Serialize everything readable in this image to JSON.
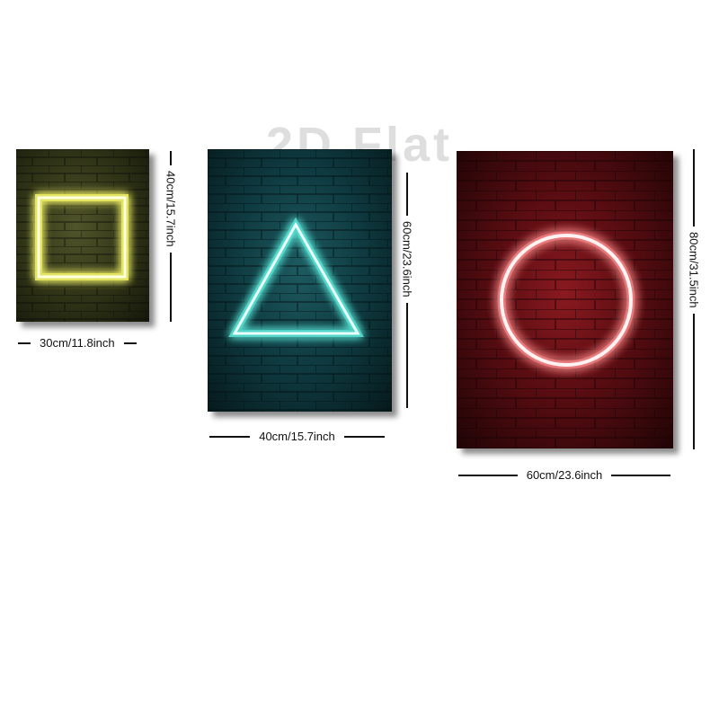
{
  "watermark": "2D Flat",
  "panels": [
    {
      "id": "square",
      "shape": "square",
      "width_label": "30cm/11.8inch",
      "height_label": "40cm/15.7inch",
      "bg_color": "#2f3316",
      "glow_color": "#ffff8a",
      "shape_icon": "neon-square-icon"
    },
    {
      "id": "triangle",
      "shape": "triangle",
      "width_label": "40cm/15.7inch",
      "height_label": "60cm/23.6inch",
      "bg_color": "#0e3a40",
      "glow_color": "#a7fff4",
      "shape_icon": "neon-triangle-icon"
    },
    {
      "id": "circle",
      "shape": "circle",
      "width_label": "60cm/23.6inch",
      "height_label": "80cm/31.5inch",
      "bg_color": "#5a0d12",
      "glow_color": "#ffd0d0",
      "shape_icon": "neon-circle-icon"
    }
  ]
}
